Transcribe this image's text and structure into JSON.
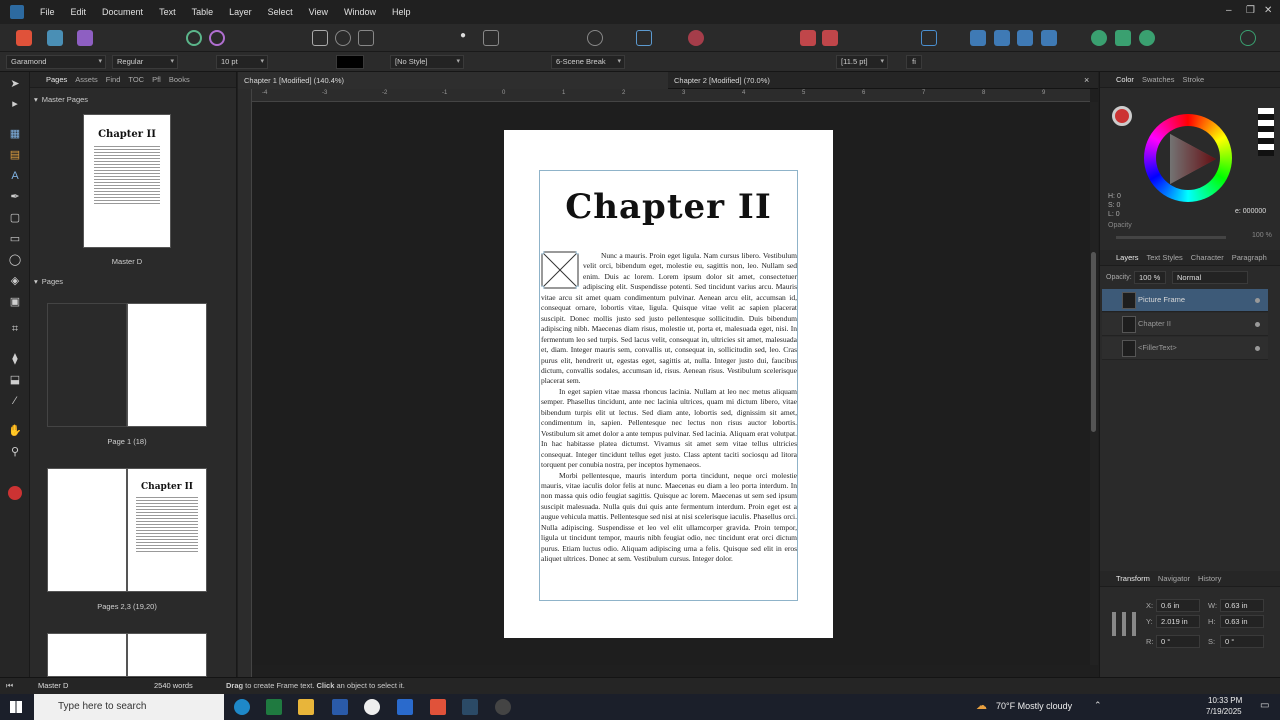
{
  "menubar": {
    "items": [
      "File",
      "Edit",
      "Document",
      "Text",
      "Table",
      "Layer",
      "Select",
      "View",
      "Window",
      "Help"
    ]
  },
  "context_toolbar": {
    "font_family": "Garamond",
    "font_style": "Regular",
    "font_size": "10 pt",
    "paragraph_style": "[No Style]",
    "text_style": "6-Scene Break",
    "leading": "[11.5 pt]"
  },
  "left_panel": {
    "tabs": [
      "Pages",
      "Assets",
      "Find",
      "TOC",
      "Pfl",
      "Books"
    ],
    "master_section": "Master Pages",
    "master_thumb_title": "Chapter II",
    "master_label": "Master D",
    "pages_section": "Pages",
    "page1_label": "Page 1 (18)",
    "page23_label": "Pages 2,3 (19,20)",
    "page3_thumb_title": "Chapter II"
  },
  "doc_tabs": {
    "tab1": "Chapter 1 [Modified] (140.4%)",
    "tab2": "Chapter 2 [Modified] (70.0%)",
    "close": "×"
  },
  "ruler_h": [
    "-4",
    "-3",
    "-2",
    "-1",
    "0",
    "1",
    "2",
    "3",
    "4",
    "5",
    "6",
    "7",
    "8",
    "9"
  ],
  "document": {
    "heading": "Chapter II",
    "paragraphs": [
      "Nunc a mauris. Proin eget ligula. Nam cursus libero. Vestibulum velit orci, bibendum eget, molestie eu, sagittis non, leo. Nullam sed enim. Duis ac lorem. Lorem ipsum dolor sit amet, consectetuer adipiscing elit. Suspendisse potenti. Sed tincidunt varius arcu. Mauris vitae arcu sit amet quam condimentum pulvinar. Aenean arcu elit, accumsan id, consequat ornare, lobortis vitae, ligula. Quisque vitae velit ac sapien placerat suscipit. Donec mollis justo sed justo pellentesque sollicitudin. Duis bibendum adipiscing nibh. Maecenas diam risus, molestie ut, porta et, malesuada eget, nisi. In fermentum leo sed turpis. Sed lacus velit, consequat in, ultricies sit amet, malesuada et, diam. Integer mauris sem, convallis ut, consequat in, sollicitudin sed, leo. Cras purus elit, hendrerit ut, egestas eget, sagittis at, nulla. Integer justo dui, faucibus dictum, convallis sodales, accumsan id, risus. Aenean risus. Vestibulum scelerisque placerat sem.",
      "In eget sapien vitae massa rhoncus lacinia. Nullam at leo nec metus aliquam semper. Phasellus tincidunt, ante nec lacinia ultrices, quam mi dictum libero, vitae bibendum turpis elit ut lectus. Sed diam ante, lobortis sed, dignissim sit amet, condimentum in, sapien. Pellentesque nec lectus non risus auctor lobortis. Vestibulum sit amet dolor a ante tempus pulvinar. Sed lacinia. Aliquam erat volutpat. In hac habitasse platea dictumst. Vivamus sit amet sem vitae tellus ultricies consequat. Integer tincidunt tellus eget justo. Class aptent taciti sociosqu ad litora torquent per conubia nostra, per inceptos hymenaeos.",
      "Morbi pellentesque, mauris interdum porta tincidunt, neque orci molestie mauris, vitae iaculis dolor felis at nunc. Maecenas eu diam a leo porta interdum. In non massa quis odio feugiat sagittis. Quisque ac lorem. Maecenas ut sem sed ipsum suscipit malesuada. Nulla quis dui quis ante fermentum interdum. Proin eget est a augue vehicula mattis. Pellentesque sed nisi at nisi scelerisque iaculis. Phasellus orci. Nulla adipiscing. Suspendisse et leo vel elit ullamcorper gravida. Proin tempor, ligula ut tincidunt tempor, mauris nibh feugiat odio, nec tincidunt erat orci dictum purus. Etiam luctus odio. Aliquam adipiscing urna a felis. Quisque sed elit in eros aliquet ultrices. Donec at sem. Vestibulum cursus. Integer dolor."
    ]
  },
  "right_panel": {
    "tabs_top": [
      "Color",
      "Swatches",
      "Stroke"
    ],
    "hsl": {
      "h": "H: 0",
      "s": "S: 0",
      "l": "L: 0"
    },
    "hex": "e: 000000",
    "opacity_label": "Opacity",
    "opacity_value": "100 %",
    "tabs_layers": [
      "Layers",
      "Text Styles",
      "Character",
      "Paragraph"
    ],
    "layer_opacity_label": "Opacity:",
    "layer_opacity": "100 %",
    "blend_mode": "Normal",
    "layers": [
      "Picture Frame",
      "Chapter II",
      "<FillerText>"
    ],
    "tabs_transform": [
      "Transform",
      "Navigator",
      "History"
    ],
    "transform": {
      "x_label": "X:",
      "x": "0.6 in",
      "y_label": "Y:",
      "y": "2.019 in",
      "w_label": "W:",
      "w": "0.63 in",
      "h_label": "H:",
      "h": "0.63 in",
      "r_label": "R:",
      "r": "0 °",
      "s_label": "S:",
      "s": "0 °"
    }
  },
  "statusbar": {
    "master": "Master D",
    "words": "2540 words",
    "hint_bold1": "Drag",
    "hint1": " to create Frame text. ",
    "hint_bold2": "Click",
    "hint2": " an object to select it."
  },
  "taskbar": {
    "search_placeholder": "Type here to search",
    "weather": "70°F  Mostly cloudy",
    "time": "10:33 PM",
    "date": "7/19/2025"
  },
  "colors": {
    "accent": "#3d5a78",
    "frame_guide": "#8fb3c9"
  }
}
